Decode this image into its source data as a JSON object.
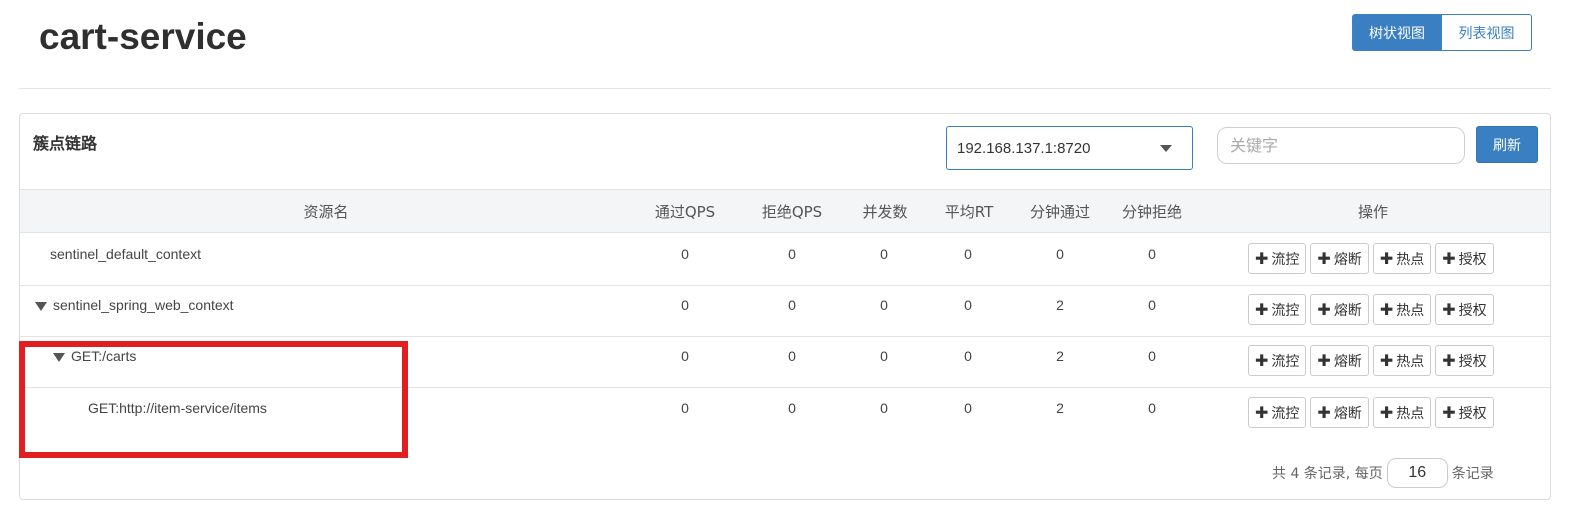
{
  "header": {
    "title": "cart-service",
    "views": [
      "树状视图",
      "列表视图"
    ],
    "active_view": "树状视图"
  },
  "panel": {
    "title": "簇点链路",
    "machine_select": "192.168.137.1:8720",
    "search_placeholder": "关键字",
    "refresh_label": "刷新"
  },
  "table": {
    "columns": [
      "资源名",
      "通过QPS",
      "拒绝QPS",
      "并发数",
      "平均RT",
      "分钟通过",
      "分钟拒绝",
      "操作"
    ],
    "rows": [
      {
        "name": "sentinel_default_context",
        "expandable": false,
        "values": [
          "0",
          "0",
          "0",
          "0",
          "0",
          "0"
        ]
      },
      {
        "name": "sentinel_spring_web_context",
        "expandable": true,
        "values": [
          "0",
          "0",
          "0",
          "0",
          "2",
          "0"
        ]
      },
      {
        "name": "GET:/carts",
        "expandable": true,
        "values": [
          "0",
          "0",
          "0",
          "0",
          "2",
          "0"
        ]
      },
      {
        "name": "GET:http://item-service/items",
        "expandable": false,
        "values": [
          "0",
          "0",
          "0",
          "0",
          "2",
          "0"
        ]
      }
    ],
    "actions": [
      "流控",
      "熔断",
      "热点",
      "授权"
    ]
  },
  "footer": {
    "prefix": "共 4 条记录, 每页",
    "page_size": "16",
    "suffix": "条记录"
  },
  "colors": {
    "primary": "#3a7fc1",
    "highlight_box": "#e02020",
    "header_bg": "#f4f5f6"
  },
  "icons": {
    "expand": "triangle-down-icon",
    "dropdown": "caret-down-icon",
    "action_add": "plus-icon"
  }
}
